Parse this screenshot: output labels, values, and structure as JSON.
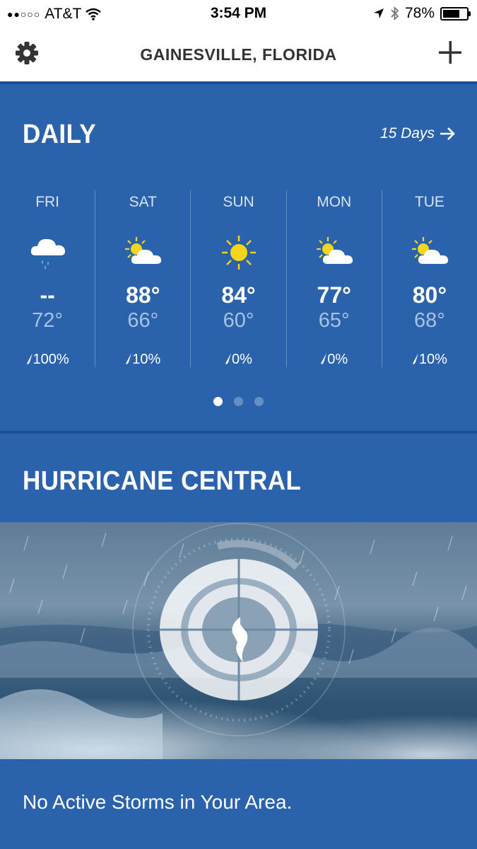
{
  "status_bar": {
    "signal": "●●○○○",
    "carrier": "AT&T",
    "time": "3:54 PM",
    "battery_percent": "78%",
    "battery_level": 0.78
  },
  "header": {
    "location": "GAINESVILLE, FLORIDA",
    "left_icon": "gear-icon",
    "right_icon": "plus-icon"
  },
  "daily": {
    "title": "DAILY",
    "more_link": "15 Days",
    "days": [
      {
        "name": "FRI",
        "icon": "rain-cloud-icon",
        "high": "--",
        "low": "72°",
        "precip": "100%"
      },
      {
        "name": "SAT",
        "icon": "partly-sunny-icon",
        "high": "88°",
        "low": "66°",
        "precip": "10%"
      },
      {
        "name": "SUN",
        "icon": "sun-icon",
        "high": "84°",
        "low": "60°",
        "precip": "0%"
      },
      {
        "name": "MON",
        "icon": "partly-sunny-icon",
        "high": "77°",
        "low": "65°",
        "precip": "0%"
      },
      {
        "name": "TUE",
        "icon": "partly-sunny-icon",
        "high": "80°",
        "low": "68°",
        "precip": "10%"
      }
    ],
    "page_count": 3,
    "active_page": 1
  },
  "hurricane": {
    "title": "HURRICANE CENTRAL",
    "message": "No Active Storms in Your Area."
  },
  "colors": {
    "panel_blue": "#2a63ac",
    "divider_blue": "#1d4f95",
    "sun_yellow": "#f7d51d"
  }
}
